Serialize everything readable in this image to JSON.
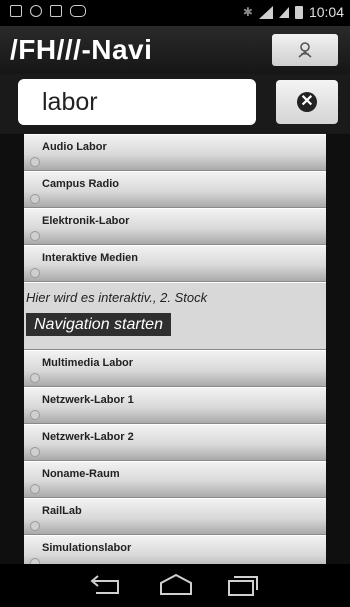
{
  "statusbar": {
    "time": "10:04",
    "icons": [
      "notification-icon",
      "call-icon",
      "image-icon",
      "gamepad-icon",
      "bluetooth-icon",
      "wifi-icon",
      "signal-icon",
      "battery-icon"
    ]
  },
  "app": {
    "title": "/FH///-Navi",
    "map_button_icon": "map-pin-icon"
  },
  "search": {
    "value": "labor",
    "clear_icon": "clear-icon"
  },
  "rooms": [
    {
      "label": "Audio Labor"
    },
    {
      "label": "Campus Radio"
    },
    {
      "label": "Elektronik-Labor"
    },
    {
      "label": "Interaktive Medien"
    }
  ],
  "expanded": {
    "description": "Hier wird es interaktiv., 2. Stock",
    "nav_button": "Navigation starten"
  },
  "rooms_after": [
    {
      "label": "Multimedia Labor"
    },
    {
      "label": "Netzwerk-Labor 1"
    },
    {
      "label": "Netzwerk-Labor 2"
    },
    {
      "label": "Noname-Raum"
    },
    {
      "label": "RailLab"
    },
    {
      "label": "Simulationslabor"
    }
  ],
  "navbar": {
    "icons": [
      "back-icon",
      "home-icon",
      "recent-apps-icon"
    ]
  }
}
